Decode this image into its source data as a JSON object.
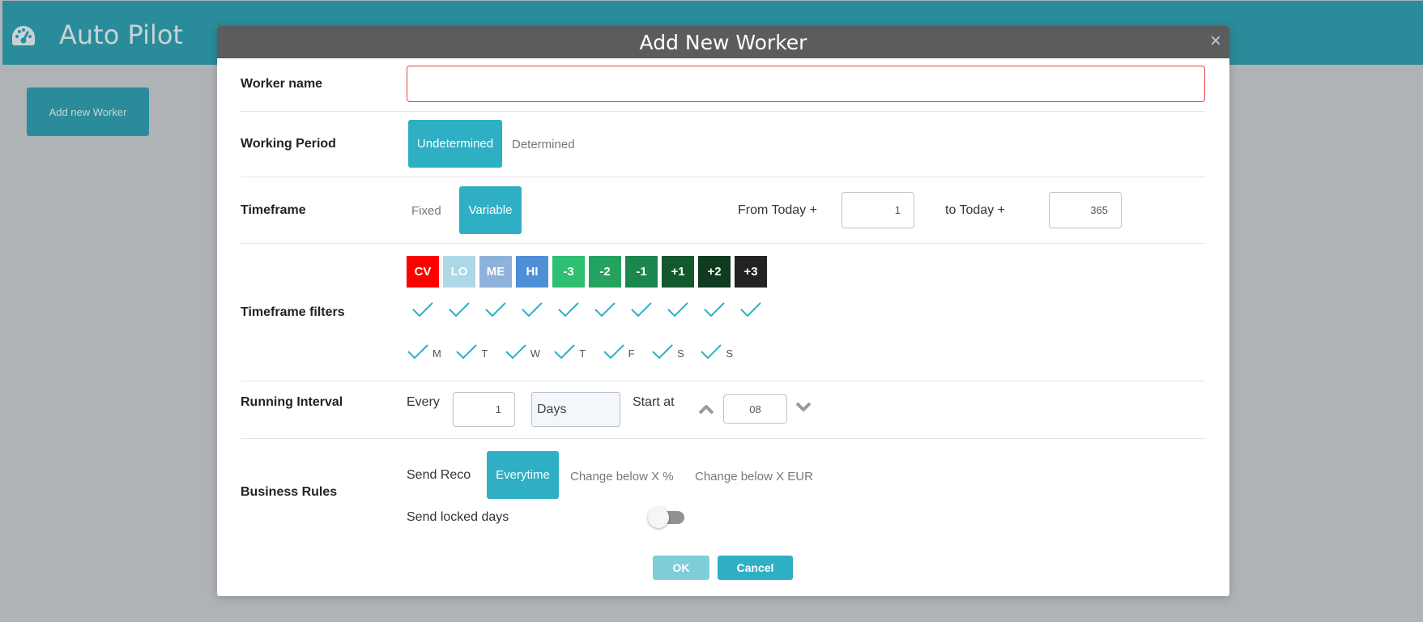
{
  "app": {
    "title": "Auto Pilot",
    "add_button_label": "Add new Worker",
    "logo_icon": "dashboard-gauge-icon",
    "header_color": "#2a8c9a"
  },
  "modal": {
    "title": "Add New Worker",
    "close_symbol": "×",
    "header_color": "#5a5c5e",
    "accent_color": "#2eafc4",
    "worker_name": {
      "label": "Worker name",
      "value": ""
    },
    "working_period": {
      "label": "Working Period",
      "options": [
        "Undetermined",
        "Determined"
      ],
      "selected": "Undetermined"
    },
    "timeframe": {
      "label": "Timeframe",
      "options": [
        "Fixed",
        "Variable"
      ],
      "selected": "Variable",
      "from_label": "From Today +",
      "from_value": "1",
      "to_label": "to Today +",
      "to_value": "365"
    },
    "timeframe_filters": {
      "label": "Timeframe filters",
      "filters": [
        {
          "label": "CV",
          "color": "#ff0000",
          "checked": true
        },
        {
          "label": "LO",
          "color": "#add8e6",
          "checked": true
        },
        {
          "label": "ME",
          "color": "#8fb2db",
          "checked": true
        },
        {
          "label": "HI",
          "color": "#4f8fd7",
          "checked": true
        },
        {
          "label": "-3",
          "color": "#2ebf72",
          "checked": true
        },
        {
          "label": "-2",
          "color": "#24a25f",
          "checked": true
        },
        {
          "label": "-1",
          "color": "#1b864d",
          "checked": true
        },
        {
          "label": "+1",
          "color": "#14582f",
          "checked": true
        },
        {
          "label": "+2",
          "color": "#0f3b20",
          "checked": true
        },
        {
          "label": "+3",
          "color": "#222222",
          "checked": true
        }
      ],
      "days": [
        {
          "label": "M",
          "checked": true
        },
        {
          "label": "T",
          "checked": true
        },
        {
          "label": "W",
          "checked": true
        },
        {
          "label": "T",
          "checked": true
        },
        {
          "label": "F",
          "checked": true
        },
        {
          "label": "S",
          "checked": true
        },
        {
          "label": "S",
          "checked": true
        }
      ]
    },
    "running_interval": {
      "label": "Running Interval",
      "every_label": "Every",
      "every_value": "1",
      "unit_value": "Days",
      "start_label": "Start at",
      "start_value": "08"
    },
    "business_rules": {
      "label": "Business Rules",
      "send_reco_label": "Send Reco",
      "options": [
        "Everytime",
        "Change below X %",
        "Change below X EUR"
      ],
      "selected": "Everytime",
      "locked_days_label": "Send locked days",
      "locked_days_enabled": false
    },
    "footer": {
      "ok_label": "OK",
      "cancel_label": "Cancel"
    }
  }
}
